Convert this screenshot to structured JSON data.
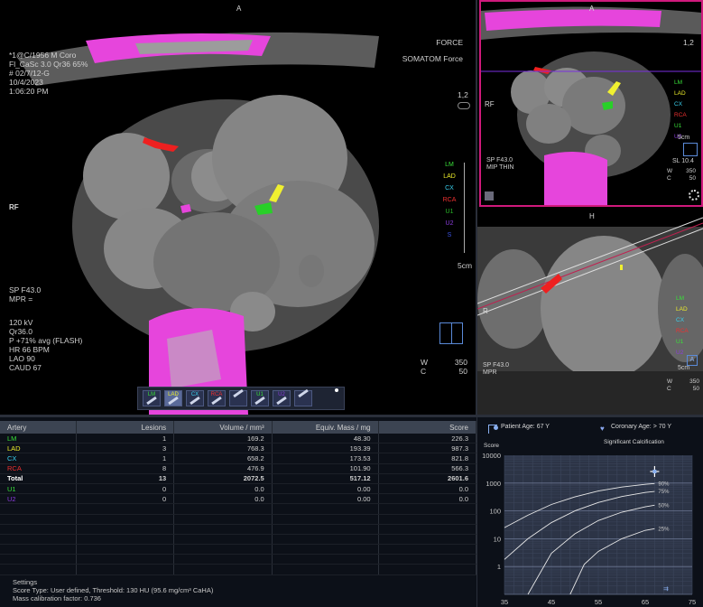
{
  "main_view": {
    "orient_top": "A",
    "orient_left": "RF",
    "top_left": [
      "*1@C/1956 M Coro",
      "Fl_CaSc 3.0 Qr36 65%",
      "# 02/7/12-G",
      "10/4/2023",
      "1:06:20 PM"
    ],
    "top_right": [
      "FORCE",
      "SOMATOM Force"
    ],
    "zoom": "1,2",
    "mid_left": [
      "SP F43.0",
      "MPR ="
    ],
    "bottom_left": [
      "120 kV",
      "Qr36.0",
      "P +71% avg (FLASH)",
      "HR 66 BPM",
      "LAO 90",
      "CAUD 67"
    ],
    "wc": [
      "W",
      "350",
      "C",
      "50"
    ],
    "scale": "5cm",
    "legend": [
      {
        "label": "LM",
        "color": "#39e039"
      },
      {
        "label": "LAD",
        "color": "#ecec2a"
      },
      {
        "label": "CX",
        "color": "#39d0ee"
      },
      {
        "label": "RCA",
        "color": "#ee3030"
      },
      {
        "label": "U1",
        "color": "#28b828"
      },
      {
        "label": "U2",
        "color": "#8a3cdc"
      },
      {
        "label": "S",
        "color": "#3a52e0"
      }
    ]
  },
  "top_right_view": {
    "orient_top": "A",
    "orient_left": "RF",
    "zoom": "1,2",
    "bottom_left": [
      "SP F43.0",
      "MIP THIN"
    ],
    "sl": "SL 10.4",
    "wc": [
      "W",
      "350",
      "C",
      "50"
    ],
    "scale": "5cm",
    "legend": [
      "LM",
      "LAD",
      "CX",
      "RCA",
      "U1",
      "U2"
    ]
  },
  "mid_right_view": {
    "orient_top": "H",
    "orient_left": "R",
    "bottom_left": [
      "SP F43.0",
      "MPR"
    ],
    "wc": [
      "W",
      "350",
      "C",
      "50"
    ],
    "scale": "5cm",
    "legend": [
      "LM",
      "LAD",
      "CX",
      "RCA",
      "U1",
      "U2"
    ],
    "a_marker": "A"
  },
  "toolbar": {
    "buttons": [
      {
        "label": "LM",
        "color": "#39e039"
      },
      {
        "label": "LAD",
        "color": "#ecec2a"
      },
      {
        "label": "CX",
        "color": "#39d0ee"
      },
      {
        "label": "RCA",
        "color": "#ee3030"
      },
      {
        "label": "",
        "color": "#ffffff"
      },
      {
        "label": "U1",
        "color": "#39e039"
      },
      {
        "label": "U2",
        "color": "#8a3cdc"
      },
      {
        "label": "",
        "color": "#ffffff"
      }
    ]
  },
  "table": {
    "headers": [
      "Artery",
      "Lesions",
      "Volume / mm³",
      "Equiv. Mass / mg",
      "Score"
    ],
    "rows": [
      {
        "artery": "LM",
        "color": "#39e039",
        "lesions": "1",
        "volume": "169.2",
        "mass": "48.30",
        "score": "226.3"
      },
      {
        "artery": "LAD",
        "color": "#ecec2a",
        "lesions": "3",
        "volume": "768.3",
        "mass": "193.39",
        "score": "987.3"
      },
      {
        "artery": "CX",
        "color": "#39d0ee",
        "lesions": "1",
        "volume": "658.2",
        "mass": "173.53",
        "score": "821.8"
      },
      {
        "artery": "RCA",
        "color": "#ee3030",
        "lesions": "8",
        "volume": "476.9",
        "mass": "101.90",
        "score": "566.3"
      },
      {
        "artery": "Total",
        "color": "#ffffff",
        "lesions": "13",
        "volume": "2072.5",
        "mass": "517.12",
        "score": "2601.6"
      },
      {
        "artery": "U1",
        "color": "#39e039",
        "lesions": "0",
        "volume": "0.0",
        "mass": "0.00",
        "score": "0.0"
      },
      {
        "artery": "U2",
        "color": "#8a3cdc",
        "lesions": "0",
        "volume": "0.0",
        "mass": "0.00",
        "score": "0.0"
      },
      {
        "artery": "",
        "color": "#ffffff",
        "lesions": "",
        "volume": "",
        "mass": "",
        "score": ""
      },
      {
        "artery": "",
        "color": "#ffffff",
        "lesions": "",
        "volume": "",
        "mass": "",
        "score": ""
      },
      {
        "artery": "",
        "color": "#ffffff",
        "lesions": "",
        "volume": "",
        "mass": "",
        "score": ""
      },
      {
        "artery": "",
        "color": "#ffffff",
        "lesions": "",
        "volume": "",
        "mass": "",
        "score": ""
      },
      {
        "artery": "",
        "color": "#ffffff",
        "lesions": "",
        "volume": "",
        "mass": "",
        "score": ""
      },
      {
        "artery": "",
        "color": "#ffffff",
        "lesions": "",
        "volume": "",
        "mass": "",
        "score": ""
      },
      {
        "artery": "",
        "color": "#ffffff",
        "lesions": "",
        "volume": "",
        "mass": "",
        "score": ""
      }
    ]
  },
  "settings": {
    "title": "Settings",
    "score_type": "Score Type: User defined, Threshold: 130 HU (95.6 mg/cm³ CaHA)",
    "mass_cal": "Mass calibration factor: 0.736"
  },
  "score_graph": {
    "score_label": "Score",
    "patient_age": "Patient Age: 67 Y",
    "coronary_age": "Coronary Age: > 70 Y",
    "significance": "Significant Calcification"
  },
  "chart_data": {
    "type": "line",
    "title": "",
    "ylabel": "Score",
    "xlabel": "",
    "x_ticks": [
      "35",
      "45",
      "55",
      "65",
      "75"
    ],
    "y_ticks": [
      "1",
      "10",
      "100",
      "1000",
      "10000"
    ],
    "xlim": [
      35,
      75
    ],
    "ylim": [
      0.1,
      10000
    ],
    "yscale": "log",
    "grid": true,
    "series": [
      {
        "name": "90%",
        "points": [
          [
            35,
            25
          ],
          [
            40,
            70
          ],
          [
            45,
            170
          ],
          [
            50,
            320
          ],
          [
            55,
            520
          ],
          [
            60,
            720
          ],
          [
            65,
            900
          ],
          [
            67,
            960
          ]
        ]
      },
      {
        "name": "75%",
        "points": [
          [
            35,
            1.8
          ],
          [
            40,
            10
          ],
          [
            45,
            38
          ],
          [
            50,
            100
          ],
          [
            55,
            200
          ],
          [
            60,
            330
          ],
          [
            65,
            460
          ],
          [
            67,
            500
          ]
        ]
      },
      {
        "name": "50%",
        "points": [
          [
            40,
            0.1
          ],
          [
            45,
            3
          ],
          [
            50,
            15
          ],
          [
            55,
            45
          ],
          [
            60,
            90
          ],
          [
            65,
            140
          ],
          [
            67,
            160
          ]
        ]
      },
      {
        "name": "25%",
        "points": [
          [
            49,
            0.1
          ],
          [
            52,
            1.2
          ],
          [
            55,
            3.5
          ],
          [
            60,
            10
          ],
          [
            65,
            20
          ],
          [
            67,
            23
          ]
        ]
      }
    ],
    "patient_point": {
      "x": 67,
      "y": 2601.6
    }
  }
}
